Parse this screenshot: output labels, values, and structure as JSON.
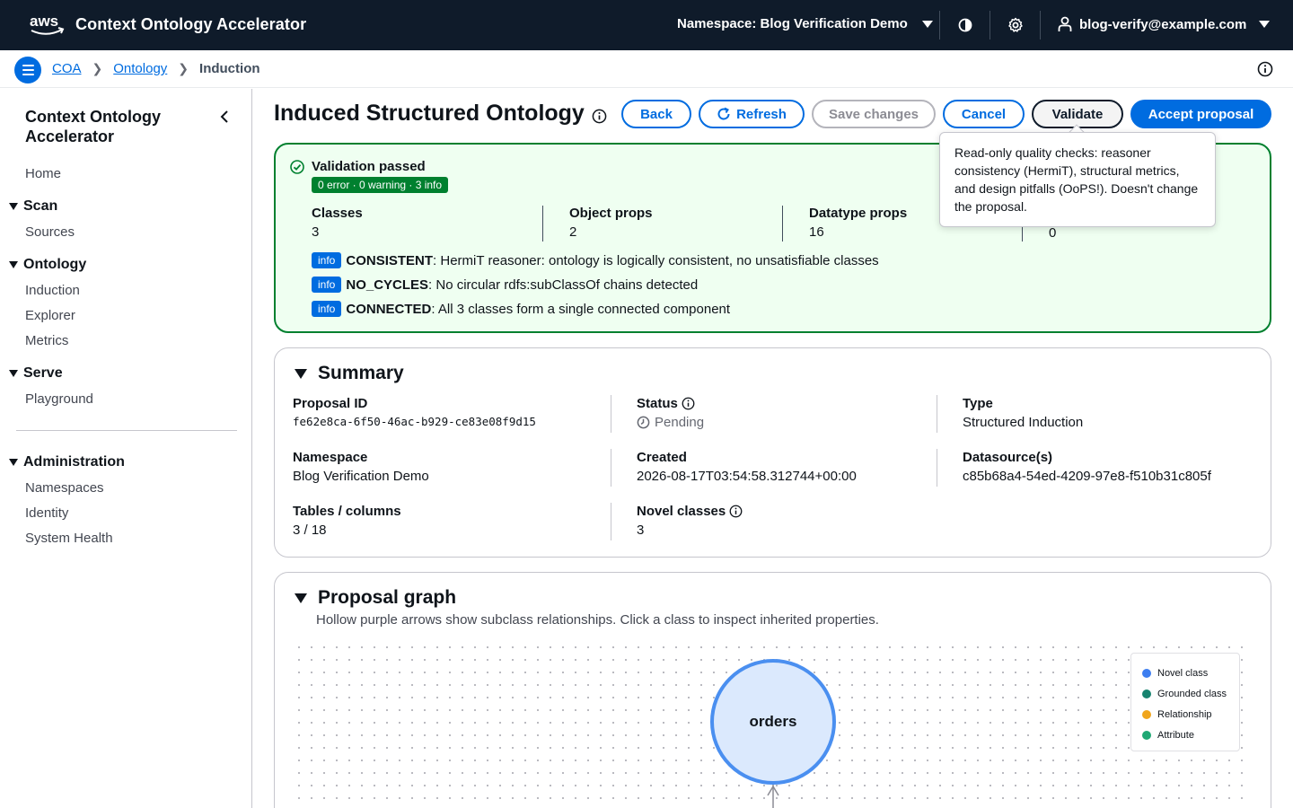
{
  "topbar": {
    "app_title": "Context Ontology Accelerator",
    "namespace_label": "Namespace: Blog Verification Demo",
    "user": "blog-verify@example.com"
  },
  "breadcrumb": {
    "items": [
      "COA",
      "Ontology"
    ],
    "current": "Induction"
  },
  "sidebar": {
    "title": "Context Ontology Accelerator",
    "home": "Home",
    "sections": [
      {
        "label": "Scan",
        "items": [
          "Sources"
        ]
      },
      {
        "label": "Ontology",
        "items": [
          "Induction",
          "Explorer",
          "Metrics"
        ]
      },
      {
        "label": "Serve",
        "items": [
          "Playground"
        ]
      },
      {
        "label": "Administration",
        "items": [
          "Namespaces",
          "Identity",
          "System Health"
        ]
      }
    ]
  },
  "page": {
    "title": "Induced Structured Ontology",
    "buttons": {
      "back": "Back",
      "refresh": "Refresh",
      "save": "Save changes",
      "cancel": "Cancel",
      "validate": "Validate",
      "accept": "Accept proposal"
    }
  },
  "validation": {
    "title": "Validation passed",
    "counts": "0 error · 0 warning · 3 info",
    "metrics": [
      {
        "label": "Classes",
        "value": "3"
      },
      {
        "label": "Object props",
        "value": "2"
      },
      {
        "label": "Datatype props",
        "value": "16"
      },
      {
        "label": "",
        "value": "0"
      }
    ],
    "checks": [
      {
        "level": "info",
        "code": "CONSISTENT",
        "text": ": HermiT reasoner: ontology is logically consistent, no unsatisfiable classes"
      },
      {
        "level": "info",
        "code": "NO_CYCLES",
        "text": ": No circular rdfs:subClassOf chains detected"
      },
      {
        "level": "info",
        "code": "CONNECTED",
        "text": ": All 3 classes form a single connected component"
      }
    ]
  },
  "tooltip": {
    "text": "Read-only quality checks: reasoner consistency (HermiT), structural metrics, and design pitfalls (OoPS!). Doesn't change the proposal."
  },
  "summary": {
    "heading": "Summary",
    "proposal_id_label": "Proposal ID",
    "proposal_id": "fe62e8ca-6f50-46ac-b929-ce83e08f9d15",
    "status_label": "Status",
    "status": "Pending",
    "type_label": "Type",
    "type": "Structured Induction",
    "namespace_label": "Namespace",
    "namespace": "Blog Verification Demo",
    "created_label": "Created",
    "created": "2026-08-17T03:54:58.312744+00:00",
    "datasource_label": "Datasource(s)",
    "datasource": "c85b68a4-54ed-4209-97e8-f510b31c805f",
    "tables_label": "Tables / columns",
    "tables": "3 / 18",
    "novel_label": "Novel classes",
    "novel": "3"
  },
  "graph": {
    "heading": "Proposal graph",
    "description": "Hollow purple arrows show subclass relationships. Click a class to inspect inherited properties.",
    "node_label": "orders",
    "legend": [
      {
        "label": "Novel class",
        "color": "#3d7ef0"
      },
      {
        "label": "Grounded class",
        "color": "#17836f"
      },
      {
        "label": "Relationship",
        "color": "#f0a51c"
      },
      {
        "label": "Attribute",
        "color": "#1fa874"
      }
    ]
  }
}
